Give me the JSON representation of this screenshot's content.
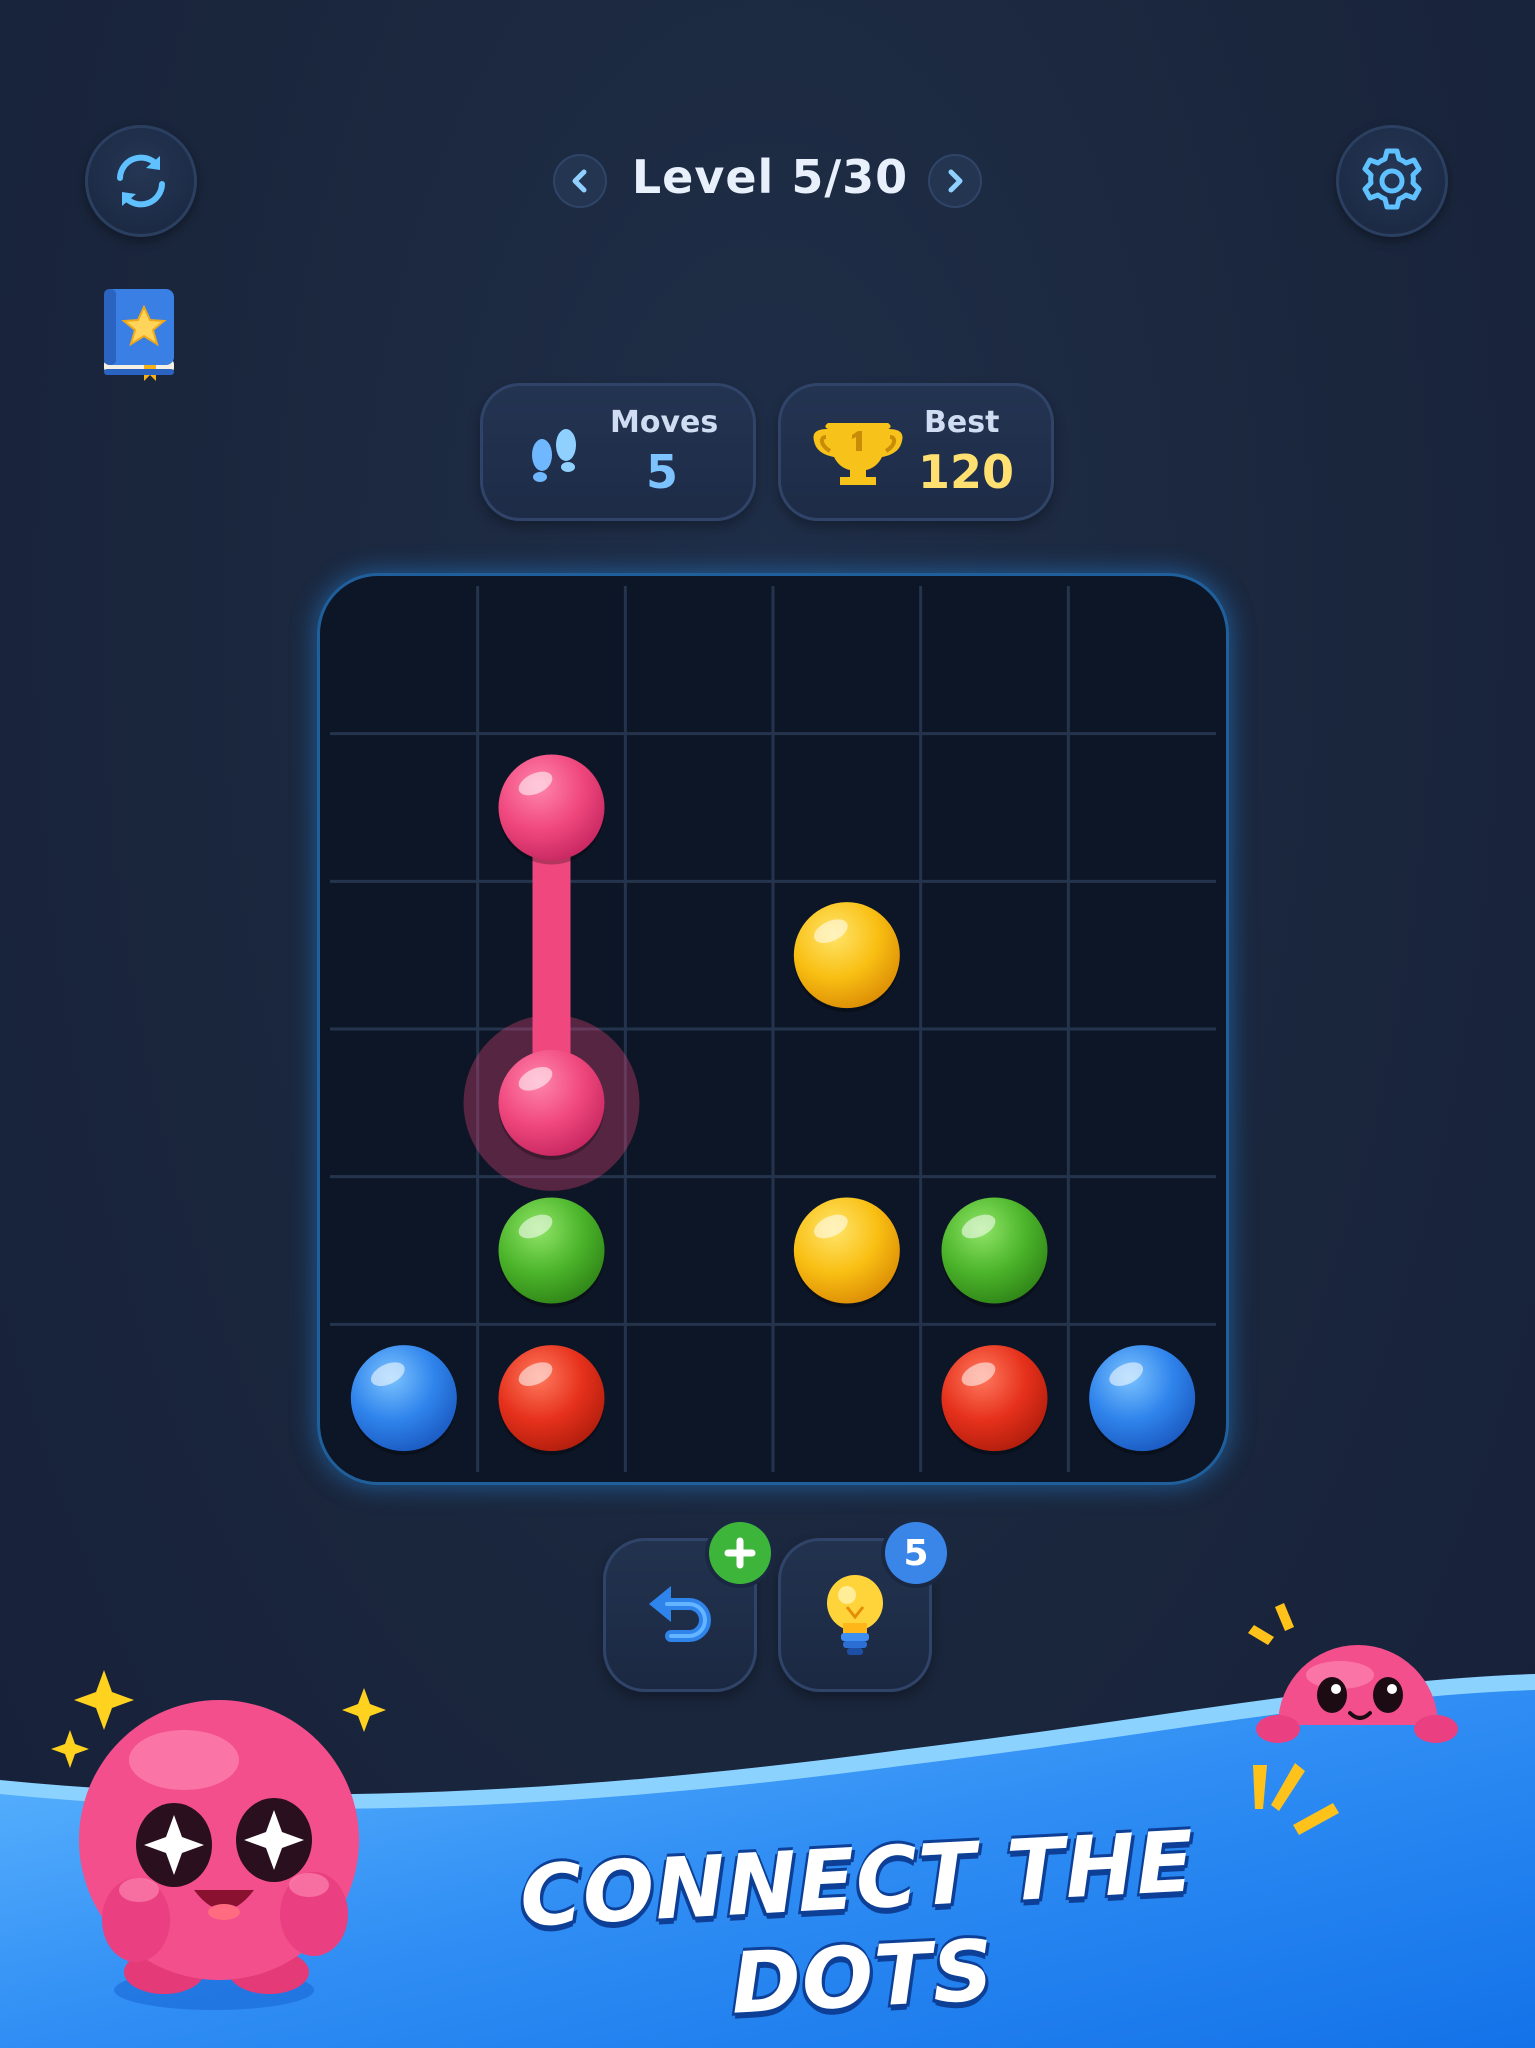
{
  "header": {
    "level_title": "Level 5/30",
    "restart_icon": "refresh-icon",
    "settings_icon": "gear-icon",
    "prev_icon": "chevron-left-icon",
    "next_icon": "chevron-right-icon",
    "rulebook_icon": "star-book-icon"
  },
  "stats": {
    "moves": {
      "label": "Moves",
      "value": "5",
      "icon": "footprints-icon"
    },
    "best": {
      "label": "Best",
      "value": "120",
      "icon": "trophy-icon"
    }
  },
  "board": {
    "size": 6,
    "colors": {
      "pink": "#f0487e",
      "yellow": "#f7b90f",
      "green": "#4cb52b",
      "blue": "#2f84ec",
      "red": "#e6311c"
    },
    "dots": [
      {
        "color": "pink",
        "row": 1,
        "col": 1
      },
      {
        "color": "pink",
        "row": 3,
        "col": 1
      },
      {
        "color": "yellow",
        "row": 2,
        "col": 3
      },
      {
        "color": "yellow",
        "row": 4,
        "col": 3
      },
      {
        "color": "green",
        "row": 4,
        "col": 1
      },
      {
        "color": "green",
        "row": 4,
        "col": 4
      },
      {
        "color": "blue",
        "row": 5,
        "col": 0
      },
      {
        "color": "blue",
        "row": 5,
        "col": 5
      },
      {
        "color": "red",
        "row": 5,
        "col": 1
      },
      {
        "color": "red",
        "row": 5,
        "col": 4
      }
    ],
    "paths": [
      {
        "color": "pink",
        "cells": [
          [
            1,
            1
          ],
          [
            2,
            1
          ],
          [
            3,
            1
          ]
        ]
      }
    ],
    "active_dot": {
      "row": 3,
      "col": 1
    }
  },
  "tools": {
    "undo": {
      "icon": "undo-icon",
      "badge_icon": "plus-icon"
    },
    "hint": {
      "icon": "lightbulb-icon",
      "badge_count": "5"
    }
  },
  "banner": {
    "title": "CONNECT THE DOTS",
    "mascot_icon": "pink-blob-mascot-icon",
    "peek_mascot_icon": "pink-blob-peeking-icon"
  }
}
